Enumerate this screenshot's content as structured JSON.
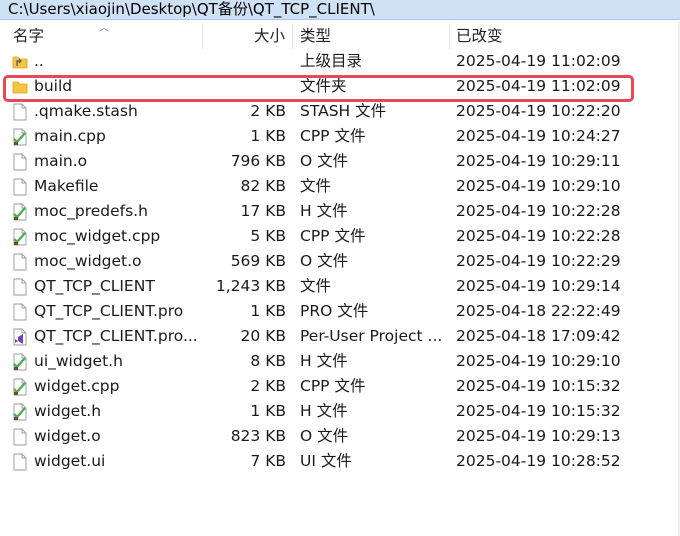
{
  "window": {
    "path": "C:\\Users\\xiaojin\\Desktop\\QT备份\\QT_TCP_CLIENT\\"
  },
  "columns": {
    "name": "名字",
    "size": "大小",
    "type": "类型",
    "modified": "已改变"
  },
  "files": [
    {
      "name": "..",
      "size": "",
      "type": "上级目录",
      "modified": "2025-04-19 11:02:09",
      "icon": "parent-folder-icon"
    },
    {
      "name": "build",
      "size": "",
      "type": "文件夹",
      "modified": "2025-04-19 11:02:09",
      "icon": "folder-icon"
    },
    {
      "name": ".qmake.stash",
      "size": "2 KB",
      "type": "STASH 文件",
      "modified": "2025-04-19 10:22:20",
      "icon": "file-icon"
    },
    {
      "name": "main.cpp",
      "size": "1 KB",
      "type": "CPP 文件",
      "modified": "2025-04-19 10:24:27",
      "icon": "source-file-icon"
    },
    {
      "name": "main.o",
      "size": "796 KB",
      "type": "O 文件",
      "modified": "2025-04-19 10:29:11",
      "icon": "file-icon"
    },
    {
      "name": "Makefile",
      "size": "82 KB",
      "type": "文件",
      "modified": "2025-04-19 10:29:10",
      "icon": "file-icon"
    },
    {
      "name": "moc_predefs.h",
      "size": "17 KB",
      "type": "H 文件",
      "modified": "2025-04-19 10:22:28",
      "icon": "source-file-icon"
    },
    {
      "name": "moc_widget.cpp",
      "size": "5 KB",
      "type": "CPP 文件",
      "modified": "2025-04-19 10:22:28",
      "icon": "source-file-icon"
    },
    {
      "name": "moc_widget.o",
      "size": "569 KB",
      "type": "O 文件",
      "modified": "2025-04-19 10:22:29",
      "icon": "file-icon"
    },
    {
      "name": "QT_TCP_CLIENT",
      "size": "1,243 KB",
      "type": "文件",
      "modified": "2025-04-19 10:29:14",
      "icon": "file-icon"
    },
    {
      "name": "QT_TCP_CLIENT.pro",
      "size": "1 KB",
      "type": "PRO 文件",
      "modified": "2025-04-18 22:22:49",
      "icon": "file-icon"
    },
    {
      "name": "QT_TCP_CLIENT.pro...",
      "size": "20 KB",
      "type": "Per-User Project ...",
      "modified": "2025-04-18 17:09:42",
      "icon": "vs-project-file-icon"
    },
    {
      "name": "ui_widget.h",
      "size": "8 KB",
      "type": "H 文件",
      "modified": "2025-04-19 10:29:10",
      "icon": "source-file-icon"
    },
    {
      "name": "widget.cpp",
      "size": "2 KB",
      "type": "CPP 文件",
      "modified": "2025-04-19 10:15:32",
      "icon": "source-file-icon"
    },
    {
      "name": "widget.h",
      "size": "1 KB",
      "type": "H 文件",
      "modified": "2025-04-19 10:15:32",
      "icon": "source-file-icon"
    },
    {
      "name": "widget.o",
      "size": "823 KB",
      "type": "O 文件",
      "modified": "2025-04-19 10:29:13",
      "icon": "file-icon"
    },
    {
      "name": "widget.ui",
      "size": "7 KB",
      "type": "UI 文件",
      "modified": "2025-04-19 10:28:52",
      "icon": "file-icon"
    }
  ],
  "highlight": {
    "row": "build",
    "color": "#e8485a"
  },
  "colors": {
    "titlebar": "#cfe1f5",
    "folder": "#f5c542",
    "source_icon_green": "#4caf50",
    "vs_purple": "#7b3fb5"
  }
}
